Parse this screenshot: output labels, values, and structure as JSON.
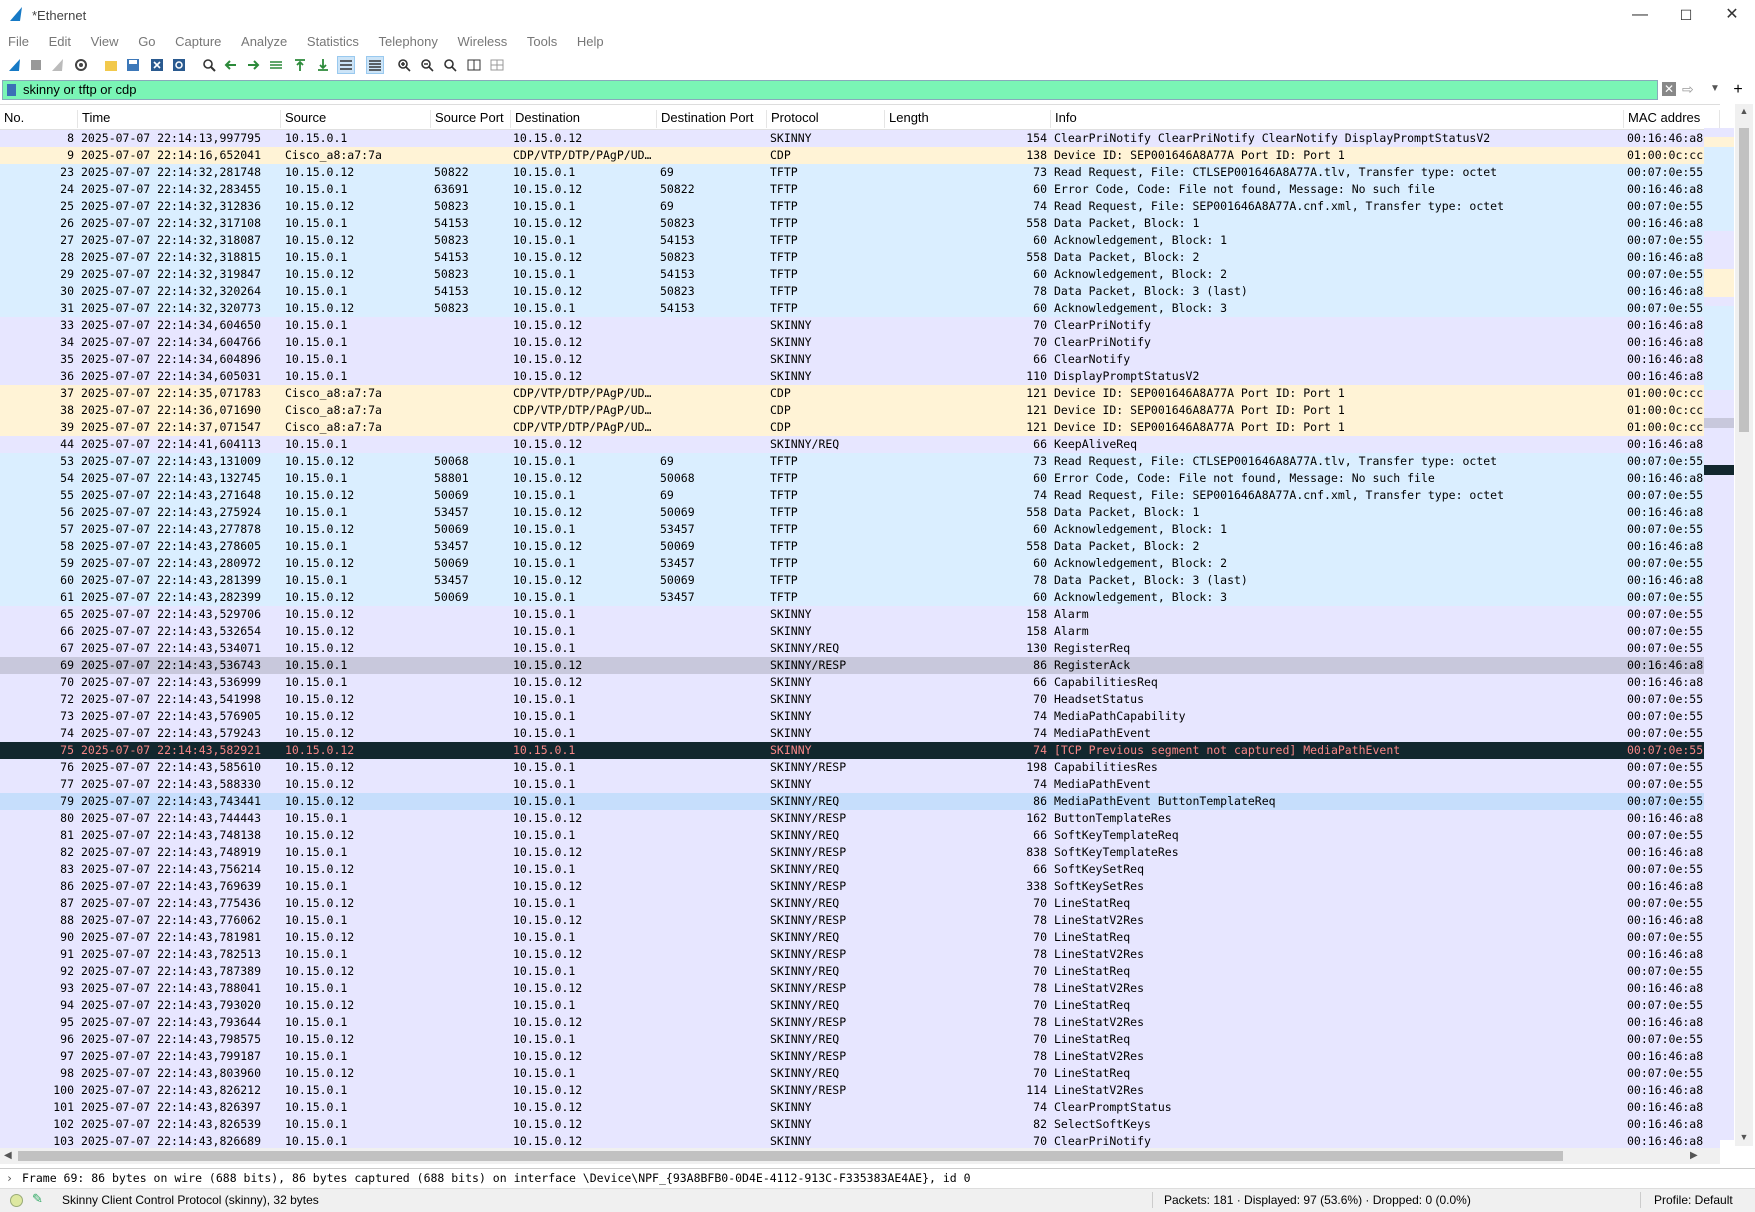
{
  "window": {
    "title": "*Ethernet",
    "minimize": "—",
    "maximize": "☐",
    "close": "✕"
  },
  "menu": [
    "File",
    "Edit",
    "View",
    "Go",
    "Capture",
    "Analyze",
    "Statistics",
    "Telephony",
    "Wireless",
    "Tools",
    "Help"
  ],
  "filter": {
    "value": "skinny or tftp or cdp"
  },
  "columns": {
    "no": "No.",
    "time": "Time",
    "source": "Source",
    "source_port": "Source Port",
    "destination": "Destination",
    "destination_port": "Destination Port",
    "protocol": "Protocol",
    "length": "Length",
    "info": "Info",
    "mac": "MAC addres"
  },
  "colors": {
    "skinny": "#e7e6ff",
    "tftp": "#daeeff",
    "cdp": "#fff3d6",
    "selected": "#c8c8dc",
    "bad": "#12272e",
    "bad_text": "#f78787",
    "filter_ok": "#7af5b5"
  },
  "packets": [
    {
      "no": "8",
      "time": "2025-07-07 22:14:13,997795",
      "src": "10.15.0.1",
      "sport": "",
      "dst": "10.15.0.12",
      "dport": "",
      "proto": "SKINNY",
      "len": "154",
      "info": "ClearPriNotify ClearPriNotify ClearNotify DisplayPromptStatusV2",
      "mac": "00:16:46:a8",
      "cls": "skinny"
    },
    {
      "no": "9",
      "time": "2025-07-07 22:14:16,652041",
      "src": "Cisco_a8:a7:7a",
      "sport": "",
      "dst": "CDP/VTP/DTP/PAgP/UD…",
      "dport": "",
      "proto": "CDP",
      "len": "138",
      "info": "Device ID: SEP001646A8A77A  Port ID: Port 1",
      "mac": "01:00:0c:cc",
      "cls": "cdp"
    },
    {
      "no": "23",
      "time": "2025-07-07 22:14:32,281748",
      "src": "10.15.0.12",
      "sport": "50822",
      "dst": "10.15.0.1",
      "dport": "69",
      "proto": "TFTP",
      "len": "73",
      "info": "Read Request, File: CTLSEP001646A8A77A.tlv, Transfer type: octet",
      "mac": "00:07:0e:55",
      "cls": "tftp"
    },
    {
      "no": "24",
      "time": "2025-07-07 22:14:32,283455",
      "src": "10.15.0.1",
      "sport": "63691",
      "dst": "10.15.0.12",
      "dport": "50822",
      "proto": "TFTP",
      "len": "60",
      "info": "Error Code, Code: File not found, Message: No such file",
      "mac": "00:16:46:a8",
      "cls": "tftp"
    },
    {
      "no": "25",
      "time": "2025-07-07 22:14:32,312836",
      "src": "10.15.0.12",
      "sport": "50823",
      "dst": "10.15.0.1",
      "dport": "69",
      "proto": "TFTP",
      "len": "74",
      "info": "Read Request, File: SEP001646A8A77A.cnf.xml, Transfer type: octet",
      "mac": "00:07:0e:55",
      "cls": "tftp"
    },
    {
      "no": "26",
      "time": "2025-07-07 22:14:32,317108",
      "src": "10.15.0.1",
      "sport": "54153",
      "dst": "10.15.0.12",
      "dport": "50823",
      "proto": "TFTP",
      "len": "558",
      "info": "Data Packet, Block: 1",
      "mac": "00:16:46:a8",
      "cls": "tftp"
    },
    {
      "no": "27",
      "time": "2025-07-07 22:14:32,318087",
      "src": "10.15.0.12",
      "sport": "50823",
      "dst": "10.15.0.1",
      "dport": "54153",
      "proto": "TFTP",
      "len": "60",
      "info": "Acknowledgement, Block: 1",
      "mac": "00:07:0e:55",
      "cls": "tftp"
    },
    {
      "no": "28",
      "time": "2025-07-07 22:14:32,318815",
      "src": "10.15.0.1",
      "sport": "54153",
      "dst": "10.15.0.12",
      "dport": "50823",
      "proto": "TFTP",
      "len": "558",
      "info": "Data Packet, Block: 2",
      "mac": "00:16:46:a8",
      "cls": "tftp"
    },
    {
      "no": "29",
      "time": "2025-07-07 22:14:32,319847",
      "src": "10.15.0.12",
      "sport": "50823",
      "dst": "10.15.0.1",
      "dport": "54153",
      "proto": "TFTP",
      "len": "60",
      "info": "Acknowledgement, Block: 2",
      "mac": "00:07:0e:55",
      "cls": "tftp"
    },
    {
      "no": "30",
      "time": "2025-07-07 22:14:32,320264",
      "src": "10.15.0.1",
      "sport": "54153",
      "dst": "10.15.0.12",
      "dport": "50823",
      "proto": "TFTP",
      "len": "78",
      "info": "Data Packet, Block: 3 (last)",
      "mac": "00:16:46:a8",
      "cls": "tftp"
    },
    {
      "no": "31",
      "time": "2025-07-07 22:14:32,320773",
      "src": "10.15.0.12",
      "sport": "50823",
      "dst": "10.15.0.1",
      "dport": "54153",
      "proto": "TFTP",
      "len": "60",
      "info": "Acknowledgement, Block: 3",
      "mac": "00:07:0e:55",
      "cls": "tftp"
    },
    {
      "no": "33",
      "time": "2025-07-07 22:14:34,604650",
      "src": "10.15.0.1",
      "sport": "",
      "dst": "10.15.0.12",
      "dport": "",
      "proto": "SKINNY",
      "len": "70",
      "info": "ClearPriNotify",
      "mac": "00:16:46:a8",
      "cls": "skinny"
    },
    {
      "no": "34",
      "time": "2025-07-07 22:14:34,604766",
      "src": "10.15.0.1",
      "sport": "",
      "dst": "10.15.0.12",
      "dport": "",
      "proto": "SKINNY",
      "len": "70",
      "info": "ClearPriNotify",
      "mac": "00:16:46:a8",
      "cls": "skinny"
    },
    {
      "no": "35",
      "time": "2025-07-07 22:14:34,604896",
      "src": "10.15.0.1",
      "sport": "",
      "dst": "10.15.0.12",
      "dport": "",
      "proto": "SKINNY",
      "len": "66",
      "info": "ClearNotify",
      "mac": "00:16:46:a8",
      "cls": "skinny"
    },
    {
      "no": "36",
      "time": "2025-07-07 22:14:34,605031",
      "src": "10.15.0.1",
      "sport": "",
      "dst": "10.15.0.12",
      "dport": "",
      "proto": "SKINNY",
      "len": "110",
      "info": "DisplayPromptStatusV2",
      "mac": "00:16:46:a8",
      "cls": "skinny"
    },
    {
      "no": "37",
      "time": "2025-07-07 22:14:35,071783",
      "src": "Cisco_a8:a7:7a",
      "sport": "",
      "dst": "CDP/VTP/DTP/PAgP/UD…",
      "dport": "",
      "proto": "CDP",
      "len": "121",
      "info": "Device ID: SEP001646A8A77A  Port ID: Port 1",
      "mac": "01:00:0c:cc",
      "cls": "cdp"
    },
    {
      "no": "38",
      "time": "2025-07-07 22:14:36,071690",
      "src": "Cisco_a8:a7:7a",
      "sport": "",
      "dst": "CDP/VTP/DTP/PAgP/UD…",
      "dport": "",
      "proto": "CDP",
      "len": "121",
      "info": "Device ID: SEP001646A8A77A  Port ID: Port 1",
      "mac": "01:00:0c:cc",
      "cls": "cdp"
    },
    {
      "no": "39",
      "time": "2025-07-07 22:14:37,071547",
      "src": "Cisco_a8:a7:7a",
      "sport": "",
      "dst": "CDP/VTP/DTP/PAgP/UD…",
      "dport": "",
      "proto": "CDP",
      "len": "121",
      "info": "Device ID: SEP001646A8A77A  Port ID: Port 1",
      "mac": "01:00:0c:cc",
      "cls": "cdp"
    },
    {
      "no": "44",
      "time": "2025-07-07 22:14:41,604113",
      "src": "10.15.0.1",
      "sport": "",
      "dst": "10.15.0.12",
      "dport": "",
      "proto": "SKINNY/REQ",
      "len": "66",
      "info": "KeepAliveReq",
      "mac": "00:16:46:a8",
      "cls": "skinny"
    },
    {
      "no": "53",
      "time": "2025-07-07 22:14:43,131009",
      "src": "10.15.0.12",
      "sport": "50068",
      "dst": "10.15.0.1",
      "dport": "69",
      "proto": "TFTP",
      "len": "73",
      "info": "Read Request, File: CTLSEP001646A8A77A.tlv, Transfer type: octet",
      "mac": "00:07:0e:55",
      "cls": "tftp"
    },
    {
      "no": "54",
      "time": "2025-07-07 22:14:43,132745",
      "src": "10.15.0.1",
      "sport": "58801",
      "dst": "10.15.0.12",
      "dport": "50068",
      "proto": "TFTP",
      "len": "60",
      "info": "Error Code, Code: File not found, Message: No such file",
      "mac": "00:16:46:a8",
      "cls": "tftp"
    },
    {
      "no": "55",
      "time": "2025-07-07 22:14:43,271648",
      "src": "10.15.0.12",
      "sport": "50069",
      "dst": "10.15.0.1",
      "dport": "69",
      "proto": "TFTP",
      "len": "74",
      "info": "Read Request, File: SEP001646A8A77A.cnf.xml, Transfer type: octet",
      "mac": "00:07:0e:55",
      "cls": "tftp"
    },
    {
      "no": "56",
      "time": "2025-07-07 22:14:43,275924",
      "src": "10.15.0.1",
      "sport": "53457",
      "dst": "10.15.0.12",
      "dport": "50069",
      "proto": "TFTP",
      "len": "558",
      "info": "Data Packet, Block: 1",
      "mac": "00:16:46:a8",
      "cls": "tftp"
    },
    {
      "no": "57",
      "time": "2025-07-07 22:14:43,277878",
      "src": "10.15.0.12",
      "sport": "50069",
      "dst": "10.15.0.1",
      "dport": "53457",
      "proto": "TFTP",
      "len": "60",
      "info": "Acknowledgement, Block: 1",
      "mac": "00:07:0e:55",
      "cls": "tftp"
    },
    {
      "no": "58",
      "time": "2025-07-07 22:14:43,278605",
      "src": "10.15.0.1",
      "sport": "53457",
      "dst": "10.15.0.12",
      "dport": "50069",
      "proto": "TFTP",
      "len": "558",
      "info": "Data Packet, Block: 2",
      "mac": "00:16:46:a8",
      "cls": "tftp"
    },
    {
      "no": "59",
      "time": "2025-07-07 22:14:43,280972",
      "src": "10.15.0.12",
      "sport": "50069",
      "dst": "10.15.0.1",
      "dport": "53457",
      "proto": "TFTP",
      "len": "60",
      "info": "Acknowledgement, Block: 2",
      "mac": "00:07:0e:55",
      "cls": "tftp"
    },
    {
      "no": "60",
      "time": "2025-07-07 22:14:43,281399",
      "src": "10.15.0.1",
      "sport": "53457",
      "dst": "10.15.0.12",
      "dport": "50069",
      "proto": "TFTP",
      "len": "78",
      "info": "Data Packet, Block: 3 (last)",
      "mac": "00:16:46:a8",
      "cls": "tftp"
    },
    {
      "no": "61",
      "time": "2025-07-07 22:14:43,282399",
      "src": "10.15.0.12",
      "sport": "50069",
      "dst": "10.15.0.1",
      "dport": "53457",
      "proto": "TFTP",
      "len": "60",
      "info": "Acknowledgement, Block: 3",
      "mac": "00:07:0e:55",
      "cls": "tftp"
    },
    {
      "no": "65",
      "time": "2025-07-07 22:14:43,529706",
      "src": "10.15.0.12",
      "sport": "",
      "dst": "10.15.0.1",
      "dport": "",
      "proto": "SKINNY",
      "len": "158",
      "info": "Alarm",
      "mac": "00:07:0e:55",
      "cls": "skinny"
    },
    {
      "no": "66",
      "time": "2025-07-07 22:14:43,532654",
      "src": "10.15.0.12",
      "sport": "",
      "dst": "10.15.0.1",
      "dport": "",
      "proto": "SKINNY",
      "len": "158",
      "info": "Alarm",
      "mac": "00:07:0e:55",
      "cls": "skinny"
    },
    {
      "no": "67",
      "time": "2025-07-07 22:14:43,534071",
      "src": "10.15.0.12",
      "sport": "",
      "dst": "10.15.0.1",
      "dport": "",
      "proto": "SKINNY/REQ",
      "len": "130",
      "info": "RegisterReq",
      "mac": "00:07:0e:55",
      "cls": "skinny"
    },
    {
      "no": "69",
      "time": "2025-07-07 22:14:43,536743",
      "src": "10.15.0.1",
      "sport": "",
      "dst": "10.15.0.12",
      "dport": "",
      "proto": "SKINNY/RESP",
      "len": "86",
      "info": "RegisterAck",
      "mac": "00:16:46:a8",
      "cls": "sel"
    },
    {
      "no": "70",
      "time": "2025-07-07 22:14:43,536999",
      "src": "10.15.0.1",
      "sport": "",
      "dst": "10.15.0.12",
      "dport": "",
      "proto": "SKINNY",
      "len": "66",
      "info": "CapabilitiesReq",
      "mac": "00:16:46:a8",
      "cls": "skinny"
    },
    {
      "no": "72",
      "time": "2025-07-07 22:14:43,541998",
      "src": "10.15.0.12",
      "sport": "",
      "dst": "10.15.0.1",
      "dport": "",
      "proto": "SKINNY",
      "len": "70",
      "info": "HeadsetStatus",
      "mac": "00:07:0e:55",
      "cls": "skinny"
    },
    {
      "no": "73",
      "time": "2025-07-07 22:14:43,576905",
      "src": "10.15.0.12",
      "sport": "",
      "dst": "10.15.0.1",
      "dport": "",
      "proto": "SKINNY",
      "len": "74",
      "info": "MediaPathCapability",
      "mac": "00:07:0e:55",
      "cls": "skinny"
    },
    {
      "no": "74",
      "time": "2025-07-07 22:14:43,579243",
      "src": "10.15.0.12",
      "sport": "",
      "dst": "10.15.0.1",
      "dport": "",
      "proto": "SKINNY",
      "len": "74",
      "info": "MediaPathEvent",
      "mac": "00:07:0e:55",
      "cls": "skinny"
    },
    {
      "no": "75",
      "time": "2025-07-07 22:14:43,582921",
      "src": "10.15.0.12",
      "sport": "",
      "dst": "10.15.0.1",
      "dport": "",
      "proto": "SKINNY",
      "len": "74",
      "info": "[TCP Previous segment not captured] MediaPathEvent",
      "mac": "00:07:0e:55",
      "cls": "bad"
    },
    {
      "no": "76",
      "time": "2025-07-07 22:14:43,585610",
      "src": "10.15.0.12",
      "sport": "",
      "dst": "10.15.0.1",
      "dport": "",
      "proto": "SKINNY/RESP",
      "len": "198",
      "info": "CapabilitiesRes",
      "mac": "00:07:0e:55",
      "cls": "skinny"
    },
    {
      "no": "77",
      "time": "2025-07-07 22:14:43,588330",
      "src": "10.15.0.12",
      "sport": "",
      "dst": "10.15.0.1",
      "dport": "",
      "proto": "SKINNY",
      "len": "74",
      "info": "MediaPathEvent",
      "mac": "00:07:0e:55",
      "cls": "skinny"
    },
    {
      "no": "79",
      "time": "2025-07-07 22:14:43,743441",
      "src": "10.15.0.12",
      "sport": "",
      "dst": "10.15.0.1",
      "dport": "",
      "proto": "SKINNY/REQ",
      "len": "86",
      "info": "MediaPathEvent ButtonTemplateReq",
      "mac": "00:07:0e:55",
      "cls": "hl"
    },
    {
      "no": "80",
      "time": "2025-07-07 22:14:43,744443",
      "src": "10.15.0.1",
      "sport": "",
      "dst": "10.15.0.12",
      "dport": "",
      "proto": "SKINNY/RESP",
      "len": "162",
      "info": "ButtonTemplateRes",
      "mac": "00:16:46:a8",
      "cls": "skinny"
    },
    {
      "no": "81",
      "time": "2025-07-07 22:14:43,748138",
      "src": "10.15.0.12",
      "sport": "",
      "dst": "10.15.0.1",
      "dport": "",
      "proto": "SKINNY/REQ",
      "len": "66",
      "info": "SoftKeyTemplateReq",
      "mac": "00:07:0e:55",
      "cls": "skinny"
    },
    {
      "no": "82",
      "time": "2025-07-07 22:14:43,748919",
      "src": "10.15.0.1",
      "sport": "",
      "dst": "10.15.0.12",
      "dport": "",
      "proto": "SKINNY/RESP",
      "len": "838",
      "info": "SoftKeyTemplateRes",
      "mac": "00:16:46:a8",
      "cls": "skinny"
    },
    {
      "no": "83",
      "time": "2025-07-07 22:14:43,756214",
      "src": "10.15.0.12",
      "sport": "",
      "dst": "10.15.0.1",
      "dport": "",
      "proto": "SKINNY/REQ",
      "len": "66",
      "info": "SoftKeySetReq",
      "mac": "00:07:0e:55",
      "cls": "skinny"
    },
    {
      "no": "86",
      "time": "2025-07-07 22:14:43,769639",
      "src": "10.15.0.1",
      "sport": "",
      "dst": "10.15.0.12",
      "dport": "",
      "proto": "SKINNY/RESP",
      "len": "338",
      "info": "SoftKeySetRes",
      "mac": "00:16:46:a8",
      "cls": "skinny"
    },
    {
      "no": "87",
      "time": "2025-07-07 22:14:43,775436",
      "src": "10.15.0.12",
      "sport": "",
      "dst": "10.15.0.1",
      "dport": "",
      "proto": "SKINNY/REQ",
      "len": "70",
      "info": "LineStatReq",
      "mac": "00:07:0e:55",
      "cls": "skinny"
    },
    {
      "no": "88",
      "time": "2025-07-07 22:14:43,776062",
      "src": "10.15.0.1",
      "sport": "",
      "dst": "10.15.0.12",
      "dport": "",
      "proto": "SKINNY/RESP",
      "len": "78",
      "info": "LineStatV2Res",
      "mac": "00:16:46:a8",
      "cls": "skinny"
    },
    {
      "no": "90",
      "time": "2025-07-07 22:14:43,781981",
      "src": "10.15.0.12",
      "sport": "",
      "dst": "10.15.0.1",
      "dport": "",
      "proto": "SKINNY/REQ",
      "len": "70",
      "info": "LineStatReq",
      "mac": "00:07:0e:55",
      "cls": "skinny"
    },
    {
      "no": "91",
      "time": "2025-07-07 22:14:43,782513",
      "src": "10.15.0.1",
      "sport": "",
      "dst": "10.15.0.12",
      "dport": "",
      "proto": "SKINNY/RESP",
      "len": "78",
      "info": "LineStatV2Res",
      "mac": "00:16:46:a8",
      "cls": "skinny"
    },
    {
      "no": "92",
      "time": "2025-07-07 22:14:43,787389",
      "src": "10.15.0.12",
      "sport": "",
      "dst": "10.15.0.1",
      "dport": "",
      "proto": "SKINNY/REQ",
      "len": "70",
      "info": "LineStatReq",
      "mac": "00:07:0e:55",
      "cls": "skinny"
    },
    {
      "no": "93",
      "time": "2025-07-07 22:14:43,788041",
      "src": "10.15.0.1",
      "sport": "",
      "dst": "10.15.0.12",
      "dport": "",
      "proto": "SKINNY/RESP",
      "len": "78",
      "info": "LineStatV2Res",
      "mac": "00:16:46:a8",
      "cls": "skinny"
    },
    {
      "no": "94",
      "time": "2025-07-07 22:14:43,793020",
      "src": "10.15.0.12",
      "sport": "",
      "dst": "10.15.0.1",
      "dport": "",
      "proto": "SKINNY/REQ",
      "len": "70",
      "info": "LineStatReq",
      "mac": "00:07:0e:55",
      "cls": "skinny"
    },
    {
      "no": "95",
      "time": "2025-07-07 22:14:43,793644",
      "src": "10.15.0.1",
      "sport": "",
      "dst": "10.15.0.12",
      "dport": "",
      "proto": "SKINNY/RESP",
      "len": "78",
      "info": "LineStatV2Res",
      "mac": "00:16:46:a8",
      "cls": "skinny"
    },
    {
      "no": "96",
      "time": "2025-07-07 22:14:43,798575",
      "src": "10.15.0.12",
      "sport": "",
      "dst": "10.15.0.1",
      "dport": "",
      "proto": "SKINNY/REQ",
      "len": "70",
      "info": "LineStatReq",
      "mac": "00:07:0e:55",
      "cls": "skinny"
    },
    {
      "no": "97",
      "time": "2025-07-07 22:14:43,799187",
      "src": "10.15.0.1",
      "sport": "",
      "dst": "10.15.0.12",
      "dport": "",
      "proto": "SKINNY/RESP",
      "len": "78",
      "info": "LineStatV2Res",
      "mac": "00:16:46:a8",
      "cls": "skinny"
    },
    {
      "no": "98",
      "time": "2025-07-07 22:14:43,803960",
      "src": "10.15.0.12",
      "sport": "",
      "dst": "10.15.0.1",
      "dport": "",
      "proto": "SKINNY/REQ",
      "len": "70",
      "info": "LineStatReq",
      "mac": "00:07:0e:55",
      "cls": "skinny"
    },
    {
      "no": "100",
      "time": "2025-07-07 22:14:43,826212",
      "src": "10.15.0.1",
      "sport": "",
      "dst": "10.15.0.12",
      "dport": "",
      "proto": "SKINNY/RESP",
      "len": "114",
      "info": "LineStatV2Res",
      "mac": "00:16:46:a8",
      "cls": "skinny"
    },
    {
      "no": "101",
      "time": "2025-07-07 22:14:43,826397",
      "src": "10.15.0.1",
      "sport": "",
      "dst": "10.15.0.12",
      "dport": "",
      "proto": "SKINNY",
      "len": "74",
      "info": "ClearPromptStatus",
      "mac": "00:16:46:a8",
      "cls": "skinny"
    },
    {
      "no": "102",
      "time": "2025-07-07 22:14:43,826539",
      "src": "10.15.0.1",
      "sport": "",
      "dst": "10.15.0.12",
      "dport": "",
      "proto": "SKINNY",
      "len": "82",
      "info": "SelectSoftKeys",
      "mac": "00:16:46:a8",
      "cls": "skinny"
    },
    {
      "no": "103",
      "time": "2025-07-07 22:14:43,826689",
      "src": "10.15.0.1",
      "sport": "",
      "dst": "10.15.0.12",
      "dport": "",
      "proto": "SKINNY",
      "len": "70",
      "info": "ClearPriNotify",
      "mac": "00:16:46:a8",
      "cls": "skinny"
    }
  ],
  "detail": {
    "text": "Frame 69: 86 bytes on wire (688 bits), 86 bytes captured (688 bits) on interface \\Device\\NPF_{93A8BFB0-0D4E-4112-913C-F335383AE4AE}, id 0"
  },
  "status": {
    "protocol": "Skinny Client Control Protocol (skinny), 32 bytes",
    "packets": "Packets: 181 · Displayed: 97 (53.6%) · Dropped: 0 (0.0%)",
    "profile": "Profile: Default"
  }
}
